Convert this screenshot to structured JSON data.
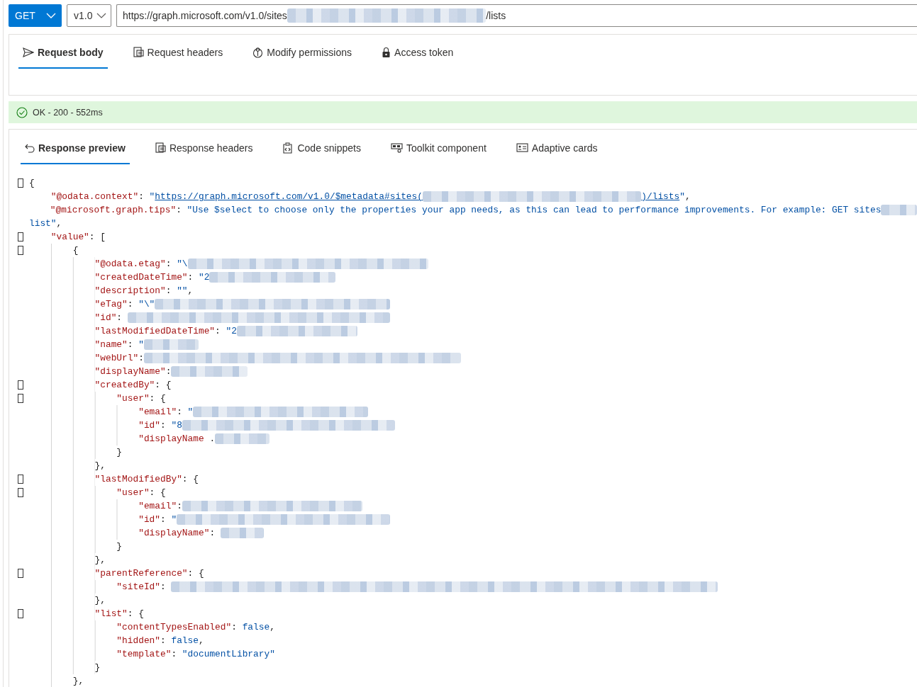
{
  "request_bar": {
    "method": "GET",
    "version": "v1.0",
    "url": [
      {
        "kind": "text",
        "text": "https://graph.microsoft.com/v1.0/sites"
      },
      {
        "kind": "redacted"
      },
      {
        "kind": "text",
        "text": "/lists"
      }
    ]
  },
  "request_tabs": [
    {
      "label": "Request body",
      "selected": true
    },
    {
      "label": "Request headers",
      "selected": false
    },
    {
      "label": "Modify permissions",
      "selected": false
    },
    {
      "label": "Access token",
      "selected": false
    }
  ],
  "status": {
    "kind": "success",
    "text": "OK - 200 - 552ms"
  },
  "response_tabs": [
    {
      "label": "Response preview",
      "selected": true
    },
    {
      "label": "Response headers",
      "selected": false
    },
    {
      "label": "Code snippets",
      "selected": false
    },
    {
      "label": "Toolkit component",
      "selected": false
    },
    {
      "label": "Adaptive cards",
      "selected": false
    }
  ],
  "code_lines": [
    {
      "fold": true,
      "tokens": [
        {
          "kind": "plain",
          "text": "{"
        }
      ]
    },
    {
      "fold": false,
      "tokens": [
        {
          "kind": "key",
          "text": "    \"@odata.context\""
        },
        {
          "kind": "plain",
          "text": ": "
        },
        {
          "kind": "string",
          "text": "\""
        },
        {
          "kind": "link",
          "text": "https://graph.microsoft.com/v1.0/$metadata#sites("
        },
        {
          "kind": "redacted"
        },
        {
          "kind": "link",
          "text": ")/lists"
        },
        {
          "kind": "string",
          "text": "\""
        },
        {
          "kind": "plain",
          "text": ","
        }
      ]
    },
    {
      "fold": false,
      "tokens": [
        {
          "kind": "key",
          "text": "    \"@microsoft.graph.tips\""
        },
        {
          "kind": "plain",
          "text": ": "
        },
        {
          "kind": "string",
          "text": "\"Use $select to choose only the properties your app needs, as this can lead to performance improvements. For example: GET sites"
        },
        {
          "kind": "redacted"
        }
      ]
    },
    {
      "fold": false,
      "tokens": [
        {
          "kind": "string",
          "text": "list\""
        },
        {
          "kind": "plain",
          "text": ","
        }
      ]
    },
    {
      "fold": true,
      "tokens": [
        {
          "kind": "key",
          "text": "    \"value\""
        },
        {
          "kind": "plain",
          "text": ": ["
        }
      ]
    },
    {
      "fold": true,
      "tokens": [
        {
          "kind": "plain",
          "text": "        {"
        }
      ]
    },
    {
      "fold": false,
      "tokens": [
        {
          "kind": "key",
          "text": "            \"@odata.etag\""
        },
        {
          "kind": "plain",
          "text": ": "
        },
        {
          "kind": "string",
          "text": "\"\\"
        },
        {
          "kind": "redacted"
        }
      ]
    },
    {
      "fold": false,
      "tokens": [
        {
          "kind": "key",
          "text": "            \"createdDateTime\""
        },
        {
          "kind": "plain",
          "text": ": "
        },
        {
          "kind": "string",
          "text": "\"2"
        },
        {
          "kind": "redacted"
        }
      ]
    },
    {
      "fold": false,
      "tokens": [
        {
          "kind": "key",
          "text": "            \"description\""
        },
        {
          "kind": "plain",
          "text": ": "
        },
        {
          "kind": "string",
          "text": "\"\""
        },
        {
          "kind": "plain",
          "text": ","
        }
      ]
    },
    {
      "fold": false,
      "tokens": [
        {
          "kind": "key",
          "text": "            \"eTag\""
        },
        {
          "kind": "plain",
          "text": ": "
        },
        {
          "kind": "string",
          "text": "\"\\\""
        },
        {
          "kind": "redacted"
        }
      ]
    },
    {
      "fold": false,
      "tokens": [
        {
          "kind": "key",
          "text": "            \"id\""
        },
        {
          "kind": "plain",
          "text": ": "
        },
        {
          "kind": "redacted"
        }
      ]
    },
    {
      "fold": false,
      "tokens": [
        {
          "kind": "key",
          "text": "            \"lastModifiedDateTime\""
        },
        {
          "kind": "plain",
          "text": ": "
        },
        {
          "kind": "string",
          "text": "\"2"
        },
        {
          "kind": "redacted"
        }
      ]
    },
    {
      "fold": false,
      "tokens": [
        {
          "kind": "key",
          "text": "            \"name\""
        },
        {
          "kind": "plain",
          "text": ": "
        },
        {
          "kind": "string",
          "text": "\""
        },
        {
          "kind": "redacted"
        }
      ]
    },
    {
      "fold": false,
      "tokens": [
        {
          "kind": "key",
          "text": "            \"webUrl\""
        },
        {
          "kind": "plain",
          "text": ":"
        },
        {
          "kind": "redacted"
        }
      ]
    },
    {
      "fold": false,
      "tokens": [
        {
          "kind": "key",
          "text": "            \"displayName\""
        },
        {
          "kind": "plain",
          "text": ":"
        },
        {
          "kind": "redacted"
        }
      ]
    },
    {
      "fold": true,
      "tokens": [
        {
          "kind": "key",
          "text": "            \"createdBy\""
        },
        {
          "kind": "plain",
          "text": ": {"
        }
      ]
    },
    {
      "fold": true,
      "tokens": [
        {
          "kind": "key",
          "text": "                \"user\""
        },
        {
          "kind": "plain",
          "text": ": {"
        }
      ]
    },
    {
      "fold": false,
      "tokens": [
        {
          "kind": "key",
          "text": "                    \"email\""
        },
        {
          "kind": "plain",
          "text": ": "
        },
        {
          "kind": "string",
          "text": "\""
        },
        {
          "kind": "redacted"
        }
      ]
    },
    {
      "fold": false,
      "tokens": [
        {
          "kind": "key",
          "text": "                    \"id\""
        },
        {
          "kind": "plain",
          "text": ": "
        },
        {
          "kind": "string",
          "text": "\"8"
        },
        {
          "kind": "redacted"
        }
      ]
    },
    {
      "fold": false,
      "tokens": [
        {
          "kind": "key",
          "text": "                    \"displayName"
        },
        {
          "kind": "plain",
          "text": " ."
        },
        {
          "kind": "redacted"
        }
      ]
    },
    {
      "fold": false,
      "tokens": [
        {
          "kind": "plain",
          "text": "                }"
        }
      ]
    },
    {
      "fold": false,
      "tokens": [
        {
          "kind": "plain",
          "text": "            },"
        }
      ]
    },
    {
      "fold": true,
      "tokens": [
        {
          "kind": "key",
          "text": "            \"lastModifiedBy\""
        },
        {
          "kind": "plain",
          "text": ": {"
        }
      ]
    },
    {
      "fold": true,
      "tokens": [
        {
          "kind": "key",
          "text": "                \"user\""
        },
        {
          "kind": "plain",
          "text": ": {"
        }
      ]
    },
    {
      "fold": false,
      "tokens": [
        {
          "kind": "key",
          "text": "                    \"email\""
        },
        {
          "kind": "plain",
          "text": ":"
        },
        {
          "kind": "redacted"
        }
      ]
    },
    {
      "fold": false,
      "tokens": [
        {
          "kind": "key",
          "text": "                    \"id\""
        },
        {
          "kind": "plain",
          "text": ": "
        },
        {
          "kind": "string",
          "text": "\""
        },
        {
          "kind": "redacted"
        }
      ]
    },
    {
      "fold": false,
      "tokens": [
        {
          "kind": "key",
          "text": "                    \"displayName\""
        },
        {
          "kind": "plain",
          "text": ": "
        },
        {
          "kind": "redacted"
        }
      ]
    },
    {
      "fold": false,
      "tokens": [
        {
          "kind": "plain",
          "text": "                }"
        }
      ]
    },
    {
      "fold": false,
      "tokens": [
        {
          "kind": "plain",
          "text": "            },"
        }
      ]
    },
    {
      "fold": true,
      "tokens": [
        {
          "kind": "key",
          "text": "            \"parentReference\""
        },
        {
          "kind": "plain",
          "text": ": {"
        }
      ]
    },
    {
      "fold": false,
      "tokens": [
        {
          "kind": "key",
          "text": "                \"siteId\""
        },
        {
          "kind": "plain",
          "text": ": "
        },
        {
          "kind": "redacted"
        }
      ]
    },
    {
      "fold": false,
      "tokens": [
        {
          "kind": "plain",
          "text": "            },"
        }
      ]
    },
    {
      "fold": true,
      "tokens": [
        {
          "kind": "key",
          "text": "            \"list\""
        },
        {
          "kind": "plain",
          "text": ": {"
        }
      ]
    },
    {
      "fold": false,
      "tokens": [
        {
          "kind": "key",
          "text": "                \"contentTypesEnabled\""
        },
        {
          "kind": "plain",
          "text": ": "
        },
        {
          "kind": "literal",
          "text": "false"
        },
        {
          "kind": "plain",
          "text": ","
        }
      ]
    },
    {
      "fold": false,
      "tokens": [
        {
          "kind": "key",
          "text": "                \"hidden\""
        },
        {
          "kind": "plain",
          "text": ": "
        },
        {
          "kind": "literal",
          "text": "false"
        },
        {
          "kind": "plain",
          "text": ","
        }
      ]
    },
    {
      "fold": false,
      "tokens": [
        {
          "kind": "key",
          "text": "                \"template\""
        },
        {
          "kind": "plain",
          "text": ": "
        },
        {
          "kind": "string",
          "text": "\"documentLibrary\""
        }
      ]
    },
    {
      "fold": false,
      "tokens": [
        {
          "kind": "plain",
          "text": "            }"
        }
      ]
    },
    {
      "fold": false,
      "tokens": [
        {
          "kind": "plain",
          "text": "        },"
        }
      ]
    }
  ]
}
